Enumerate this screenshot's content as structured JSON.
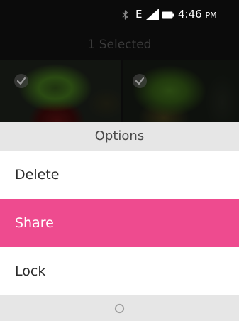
{
  "status_bar": {
    "bluetooth_icon": "bluetooth-icon",
    "network_type": "E",
    "signal_icon": "signal-icon",
    "battery_icon": "battery-icon",
    "time": "4:46",
    "ampm": "PM"
  },
  "gallery": {
    "header_text": "1 Selected",
    "check_icon": "check-circle-icon"
  },
  "options": {
    "title": "Options",
    "items": [
      {
        "label": "Delete",
        "selected": false
      },
      {
        "label": "Share",
        "selected": true
      },
      {
        "label": "Lock",
        "selected": false
      }
    ]
  },
  "softkey": {
    "center_icon": "circle-icon"
  },
  "colors": {
    "selected_item": "#ee4b8f",
    "sheet_bar": "#e6e6e6"
  }
}
